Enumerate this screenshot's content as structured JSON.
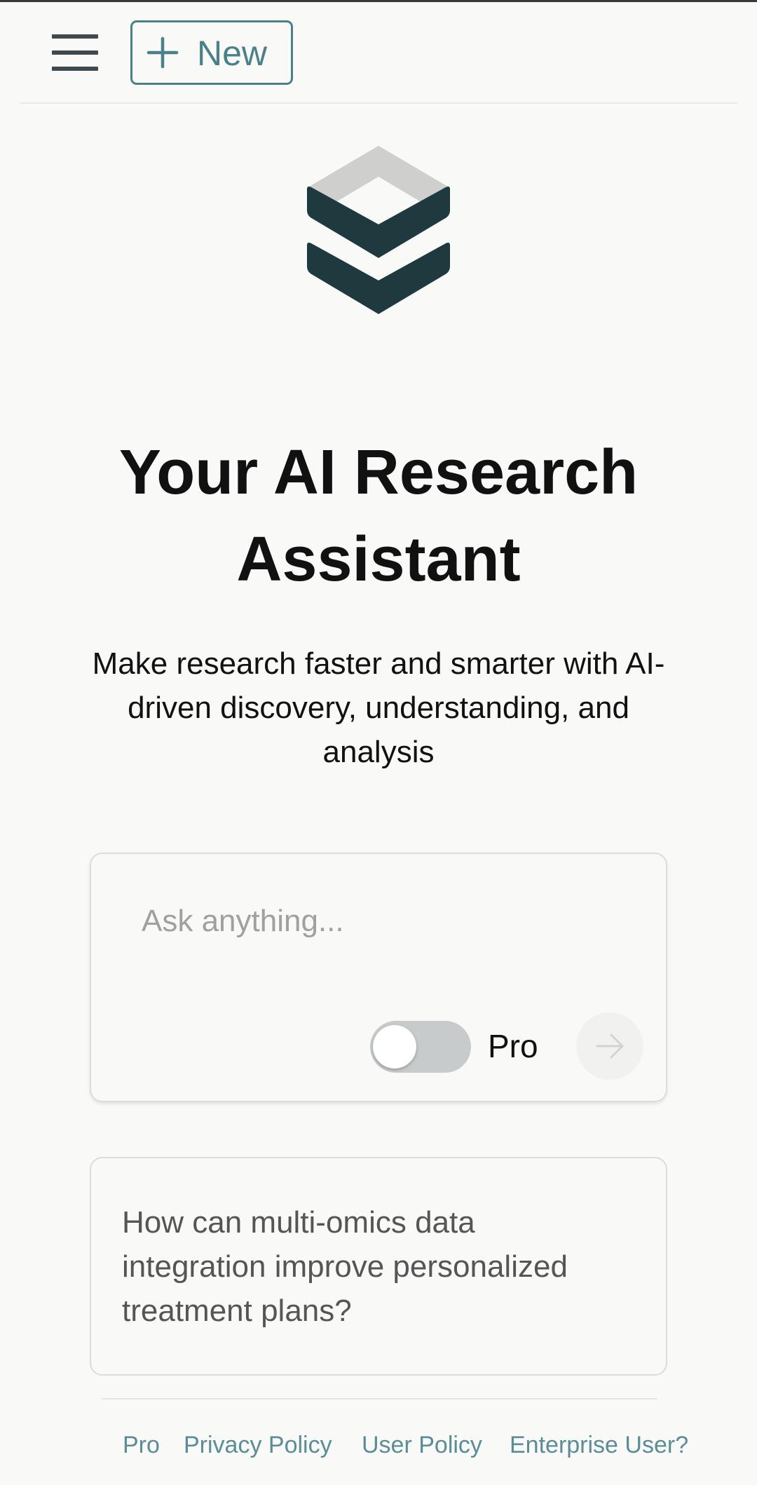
{
  "header": {
    "menu_icon": "hamburger-menu-icon",
    "new_button": {
      "icon": "plus-icon",
      "label": "New"
    }
  },
  "logo": {
    "icon": "stacked-layers-logo",
    "colors": {
      "top": "#cfcfcd",
      "dark": "#1e3a3e"
    }
  },
  "hero": {
    "title_line1": "Your AI Research",
    "title_line2": "Assistant",
    "subtitle_line1": "Make research faster and smarter with AI-",
    "subtitle_line2": "driven discovery, understanding, and",
    "subtitle_line3": "analysis"
  },
  "ask": {
    "placeholder": "Ask anything...",
    "value": "",
    "pro_toggle": {
      "label": "Pro",
      "enabled": false
    },
    "send_icon": "arrow-right-icon"
  },
  "suggestion": {
    "line1": "How can multi-omics data",
    "line2": "integration improve personalized",
    "line3": "treatment plans?"
  },
  "footer": {
    "links": [
      "Pro",
      "Privacy Policy",
      "User Policy",
      "Enterprise User?"
    ]
  },
  "colors": {
    "accent": "#4a8088",
    "link": "#5a8d96",
    "background": "#f9f9f8"
  }
}
